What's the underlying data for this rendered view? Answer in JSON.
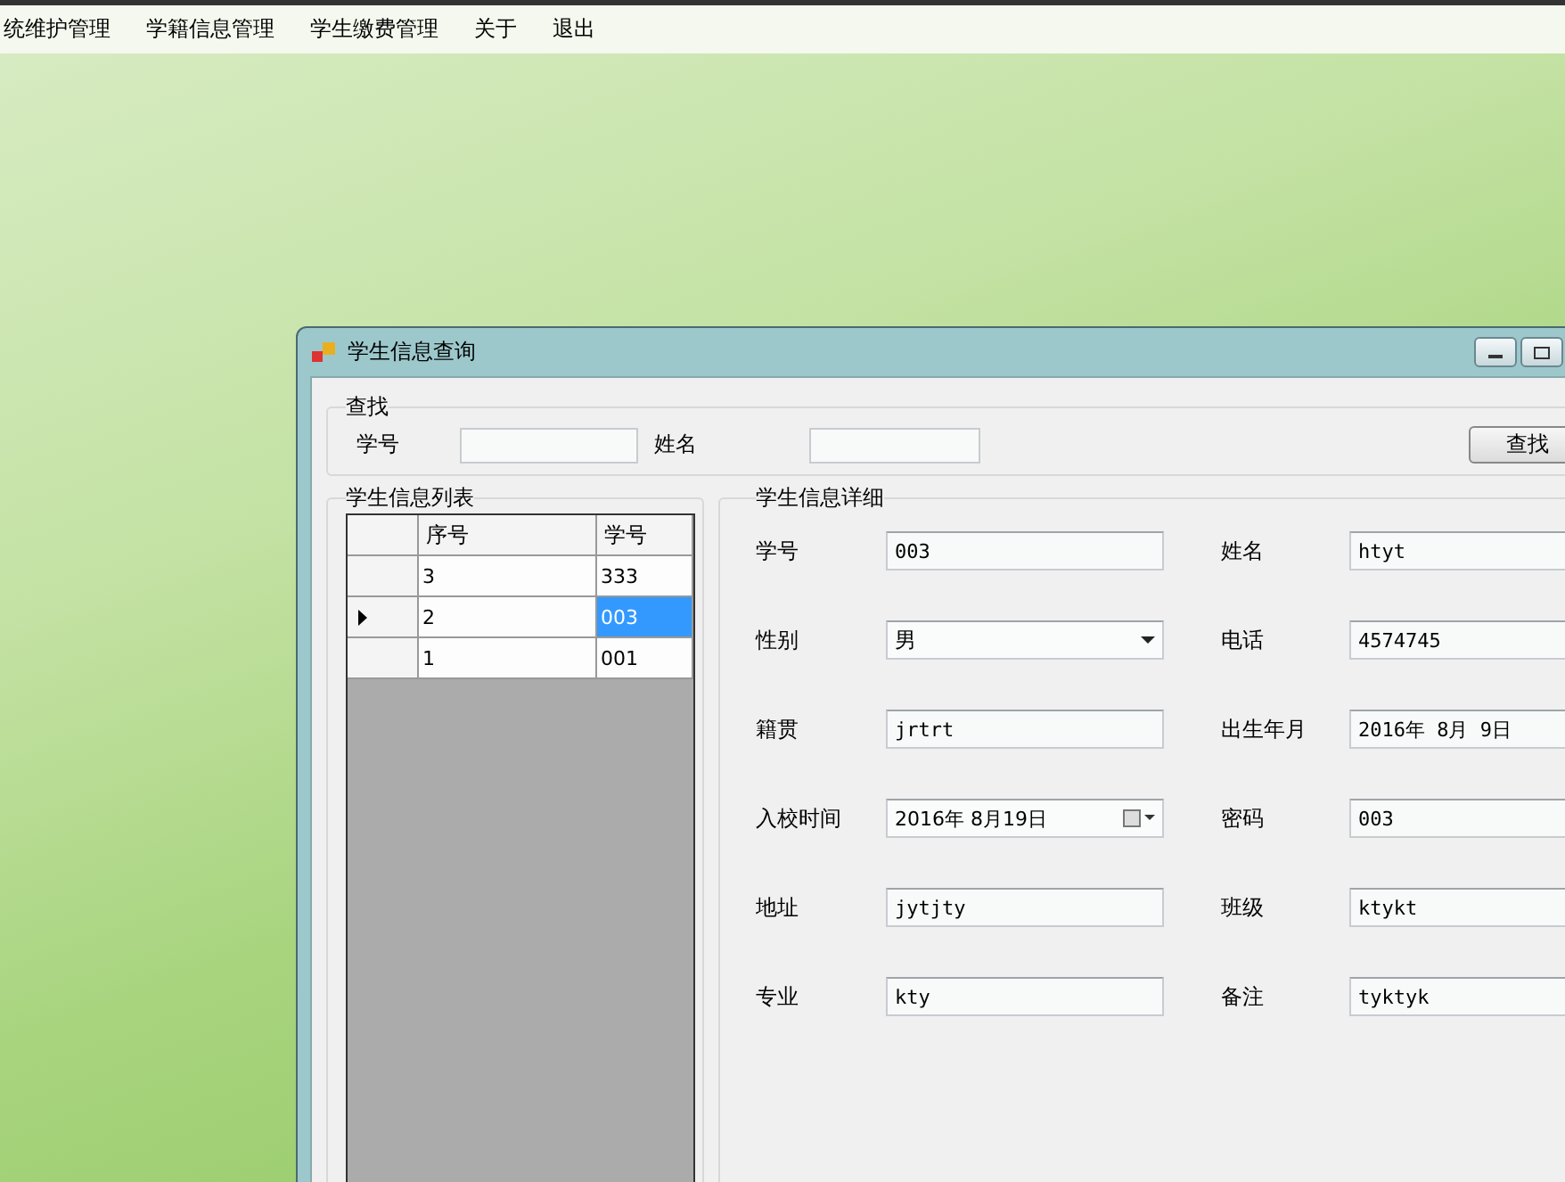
{
  "menu": [
    "统维护管理",
    "学籍信息管理",
    "学生缴费管理",
    "关于",
    "退出"
  ],
  "window": {
    "title": "学生信息查询"
  },
  "search": {
    "title": "查找",
    "fields": [
      {
        "label": "学号"
      },
      {
        "label": "姓名"
      }
    ],
    "button": "查找"
  },
  "list": {
    "title": "学生信息列表",
    "columns": [
      "序号",
      "学号"
    ],
    "rows": [
      {
        "cells": [
          "3",
          "333"
        ],
        "selected": false
      },
      {
        "cells": [
          "2",
          "003"
        ],
        "selected": true
      },
      {
        "cells": [
          "1",
          "001"
        ],
        "selected": false
      }
    ]
  },
  "detail": {
    "title": "学生信息详细",
    "fields": [
      {
        "label": "学号",
        "value": "003",
        "kind": "text"
      },
      {
        "label": "姓名",
        "value": "htyt",
        "kind": "text"
      },
      {
        "label": "性别",
        "value": "男",
        "kind": "combo"
      },
      {
        "label": "电话",
        "value": "4574745",
        "kind": "text"
      },
      {
        "label": "籍贯",
        "value": "jrtrt",
        "kind": "text"
      },
      {
        "label": "出生年月",
        "value": "2016年 8月 9日",
        "kind": "text"
      },
      {
        "label": "入校时间",
        "value": "2016年 8月19日",
        "kind": "date"
      },
      {
        "label": "密码",
        "value": "003",
        "kind": "text"
      },
      {
        "label": "地址",
        "value": "jytjty",
        "kind": "text"
      },
      {
        "label": "班级",
        "value": "ktykt",
        "kind": "text"
      },
      {
        "label": "专业",
        "value": "kty",
        "kind": "text"
      },
      {
        "label": "备注",
        "value": "tyktyk",
        "kind": "text"
      }
    ]
  }
}
